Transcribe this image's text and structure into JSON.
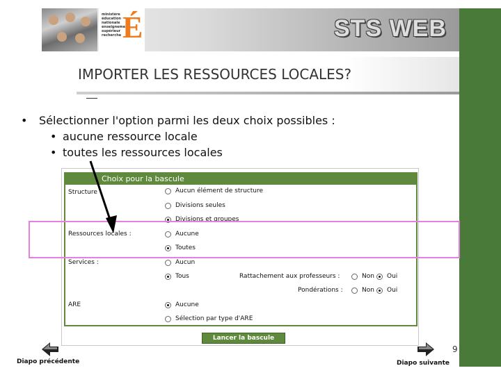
{
  "banner": {
    "app_title": "STS WEB",
    "logo_lines": [
      "ministère",
      "éducation",
      "nationale",
      "enseignement",
      "supérieur",
      "recherche"
    ],
    "logo_letter": "É"
  },
  "slide": {
    "title": "IMPORTER LES RESSOURCES LOCALES?",
    "bullet_main": "Sélectionner l'option parmi les deux choix possibles :",
    "sub_bullets": [
      "aucune ressource locale",
      "toutes les ressources locales"
    ],
    "page_number": "9"
  },
  "form": {
    "header": "Choix pour la bascule",
    "structure_label": "Structure :",
    "structure_options": [
      "Aucun élément de structure",
      "Divisions seules",
      "Divisions et groupes"
    ],
    "ressources_label": "Ressources locales :",
    "ressources_options": [
      "Aucune",
      "Toutes"
    ],
    "services_label": "Services :",
    "services_options": [
      "Aucun",
      "Tous"
    ],
    "rattachement_label": "Rattachement aux professeurs :",
    "ponderations_label": "Pondérations :",
    "non": "Non",
    "oui": "Oui",
    "are_label": "ARE",
    "are_options": [
      "Aucune",
      "Sélection par type d'ARE"
    ],
    "submit_label": "Lancer la bascule"
  },
  "nav": {
    "prev_label": "Diapo précédente",
    "next_label": "Diapo suivante"
  },
  "colors": {
    "green": "#5f8a3e",
    "strip": "#4a7a3a",
    "highlight": "#e680e0",
    "logo_orange": "#f07a1c"
  }
}
